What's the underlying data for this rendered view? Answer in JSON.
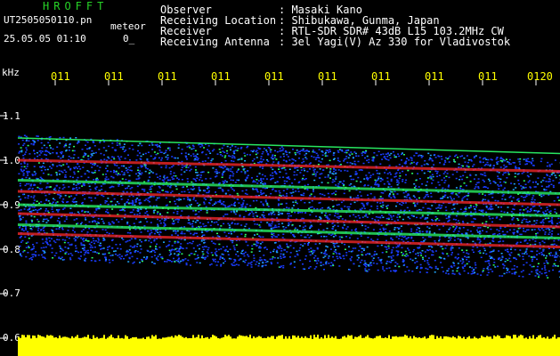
{
  "app": {
    "title": "HROFFT"
  },
  "file": {
    "name": "UT2505050110.pn",
    "suffix": "meteor"
  },
  "timestamp": {
    "date_time": "25.05.05 01:10",
    "status": "0_"
  },
  "info": {
    "observer_label": "Observer",
    "observer_value": ": Masaki Kano",
    "location_label": "Receiving Location",
    "location_value": ": Shibukawa, Gunma, Japan",
    "receiver_label": "Receiver",
    "receiver_value": ": RTL-SDR SDR# 43dB L15 103.2MHz CW",
    "antenna_label": "Receiving Antenna",
    "antenna_value": ": 3el Yagi(V) Az 330 for Vladivostok"
  },
  "axes": {
    "y_unit": "kHz",
    "y_ticks": [
      "1.1",
      "1.0",
      "0.9",
      "0.8",
      "0.7",
      "0.6"
    ],
    "x_ticks": [
      "011",
      "011",
      "011",
      "011",
      "011",
      "011",
      "011",
      "011",
      "011",
      "0120"
    ]
  },
  "colors": {
    "background": "#000000",
    "title_green": "#27d327",
    "tick_yellow": "#ffff00",
    "noise_blue": "#1a3cff",
    "signal_red": "#ff2a2a",
    "signal_green": "#2cff6a",
    "audio_yellow": "#ffff00"
  },
  "waterfall": {
    "y_range_khz": [
      0.6,
      1.15
    ],
    "traces_khz_start_end": [
      [
        1.05,
        1.015
      ],
      [
        1.0,
        0.975
      ],
      [
        0.955,
        0.925
      ],
      [
        0.93,
        0.9
      ],
      [
        0.9,
        0.875
      ],
      [
        0.88,
        0.85
      ],
      [
        0.855,
        0.825
      ],
      [
        0.835,
        0.805
      ]
    ]
  }
}
